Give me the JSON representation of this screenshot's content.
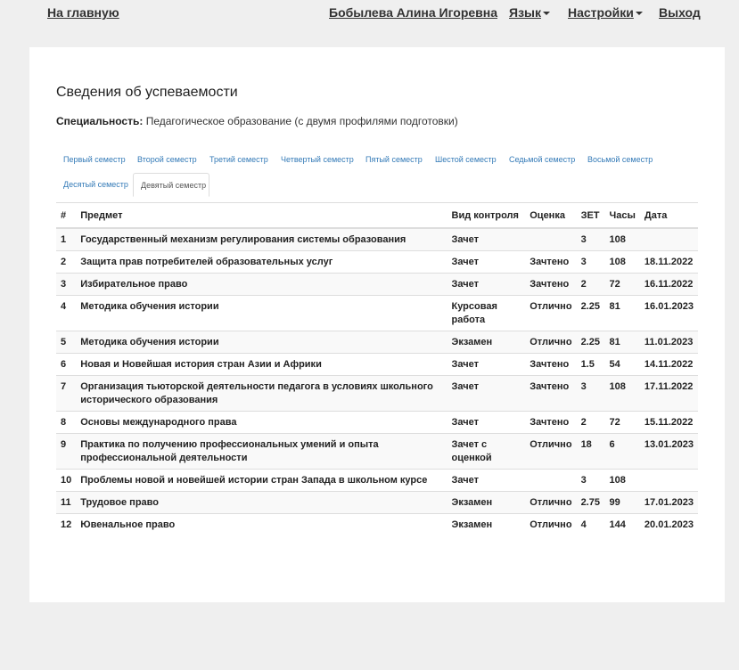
{
  "nav": {
    "home": "На главную",
    "user": "Бобылева Алина Игоревна",
    "language": "Язык",
    "settings": "Настройки",
    "logout": "Выход"
  },
  "page": {
    "title": "Сведения об успеваемости",
    "specialty_label": "Специальность:",
    "specialty_value": "Педагогическое образование (с двумя профилями подготовки)"
  },
  "tabs": [
    "Первый семестр",
    "Второй семестр",
    "Третий семестр",
    "Четвертый семестр",
    "Пятый семестр",
    "Шестой семестр",
    "Седьмой семестр",
    "Восьмой семестр",
    "Десятый семестр",
    "Девятый семестр"
  ],
  "active_tab": 9,
  "table": {
    "headers": [
      "#",
      "Предмет",
      "Вид контроля",
      "Оценка",
      "ЗЕТ",
      "Часы",
      "Дата"
    ],
    "rows": [
      [
        "1",
        "Государственный механизм регулирования системы образования",
        "Зачет",
        "",
        "3",
        "108",
        ""
      ],
      [
        "2",
        "Защита прав потребителей образовательных услуг",
        "Зачет",
        "Зачтено",
        "3",
        "108",
        "18.11.2022"
      ],
      [
        "3",
        "Избирательное право",
        "Зачет",
        "Зачтено",
        "2",
        "72",
        "16.11.2022"
      ],
      [
        "4",
        "Методика обучения истории",
        "Курсовая работа",
        "Отлично",
        "2.25",
        "81",
        "16.01.2023"
      ],
      [
        "5",
        "Методика обучения истории",
        "Экзамен",
        "Отлично",
        "2.25",
        "81",
        "11.01.2023"
      ],
      [
        "6",
        "Новая и Новейшая история стран Азии и Африки",
        "Зачет",
        "Зачтено",
        "1.5",
        "54",
        "14.11.2022"
      ],
      [
        "7",
        "Организация тьюторской деятельности педагога в условиях школьного исторического образования",
        "Зачет",
        "Зачтено",
        "3",
        "108",
        "17.11.2022"
      ],
      [
        "8",
        "Основы международного права",
        "Зачет",
        "Зачтено",
        "2",
        "72",
        "15.11.2022"
      ],
      [
        "9",
        "Практика по получению профессиональных умений и опыта профессиональной деятельности",
        "Зачет с оценкой",
        "Отлично",
        "18",
        "6",
        "13.01.2023"
      ],
      [
        "10",
        "Проблемы новой и новейшей истории стран Запада в школьном курсе",
        "Зачет",
        "",
        "3",
        "108",
        ""
      ],
      [
        "11",
        "Трудовое право",
        "Экзамен",
        "Отлично",
        "2.75",
        "99",
        "17.01.2023"
      ],
      [
        "12",
        "Ювенальное право",
        "Экзамен",
        "Отлично",
        "4",
        "144",
        "20.01.2023"
      ]
    ]
  }
}
